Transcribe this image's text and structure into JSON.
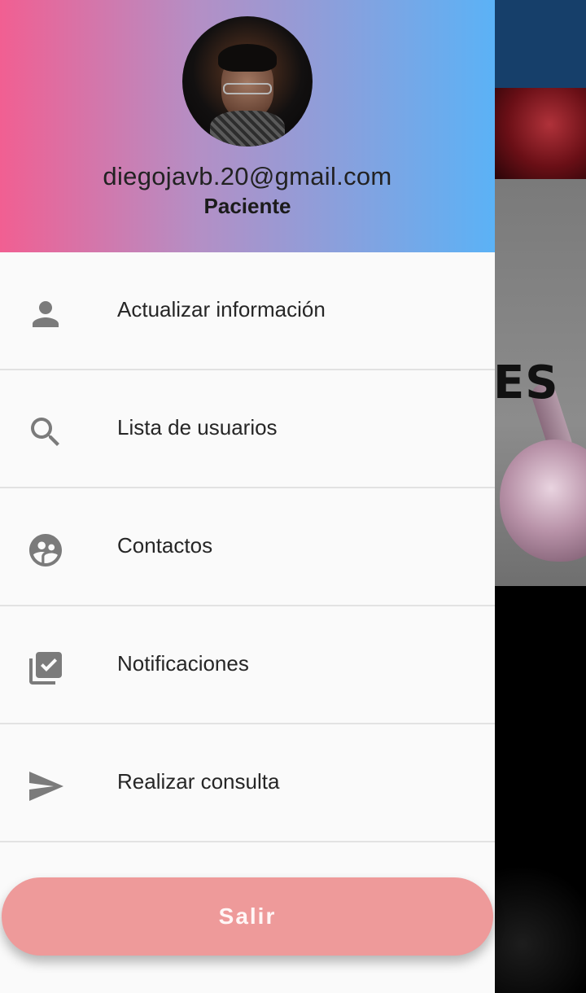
{
  "background": {
    "card_text": "ES"
  },
  "drawer": {
    "header": {
      "email": "diegojavb.20@gmail.com",
      "role": "Paciente",
      "gradient": [
        "#f15f92",
        "#5bb2f6"
      ]
    },
    "items": [
      {
        "label": "Actualizar información",
        "icon": "person-icon"
      },
      {
        "label": "Lista de usuarios",
        "icon": "search-icon"
      },
      {
        "label": "Contactos",
        "icon": "contacts-face-icon"
      },
      {
        "label": "Notificaciones",
        "icon": "library-check-icon"
      },
      {
        "label": "Realizar consulta",
        "icon": "send-icon"
      }
    ],
    "exit_button": {
      "label": "Salir",
      "color": "#ee9a9a"
    }
  }
}
